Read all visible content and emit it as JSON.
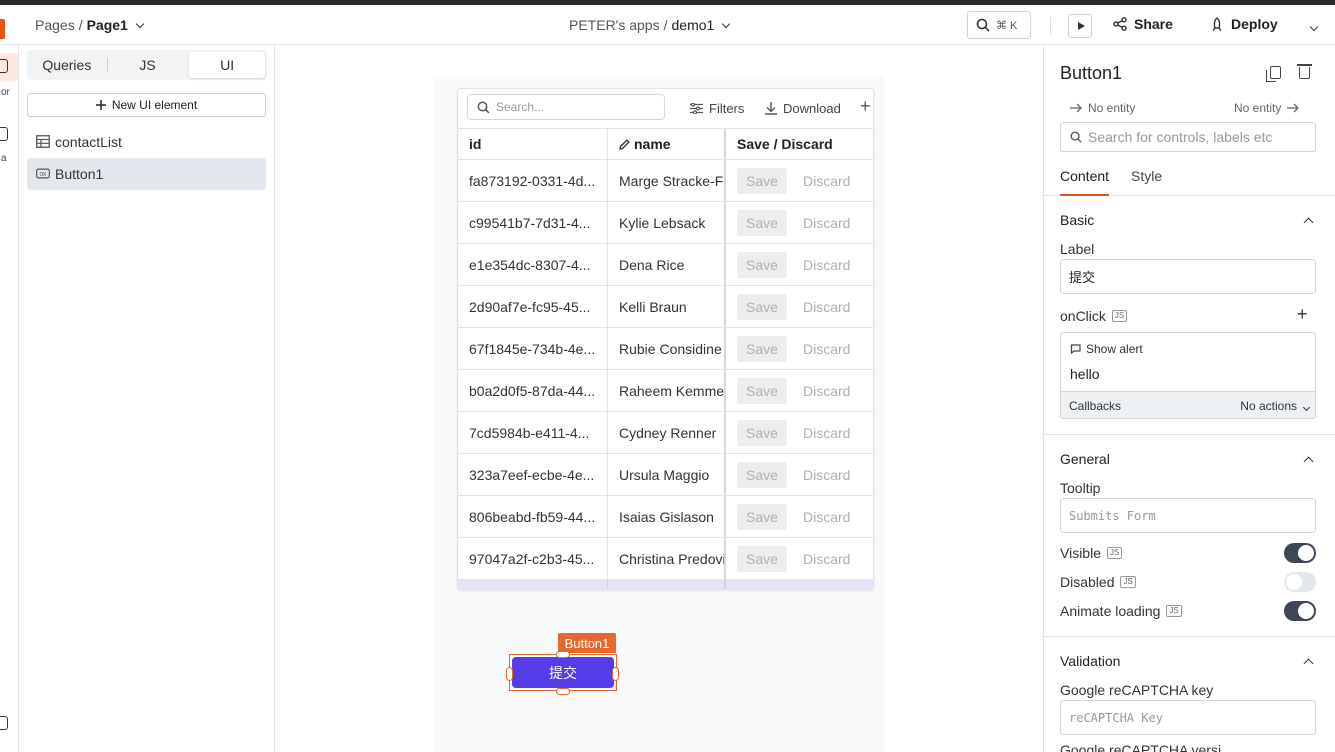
{
  "header": {
    "breadcrumb_root": "Pages",
    "breadcrumb_sep": "/",
    "breadcrumb_page": "Page1",
    "workspace": "PETER's apps",
    "app_sep": "/",
    "app_name": "demo1",
    "search_shortcut": "⌘ K",
    "share_label": "Share",
    "deploy_label": "Deploy"
  },
  "rail": {
    "label_top": "or",
    "label_mid": "a"
  },
  "left_panel": {
    "tabs": [
      "Queries",
      "JS",
      "UI"
    ],
    "active_tab": "UI",
    "new_element_label": "New UI element",
    "items": [
      {
        "label": "contactList",
        "icon": "table-icon",
        "selected": false
      },
      {
        "label": "Button1",
        "icon": "button-widget-icon",
        "selected": true
      }
    ]
  },
  "table": {
    "search_placeholder": "Search...",
    "filters_label": "Filters",
    "download_label": "Download",
    "columns": [
      "id",
      "name",
      "Save / Discard"
    ],
    "save_label": "Save",
    "discard_label": "Discard",
    "rows": [
      {
        "id": "fa873192-0331-4d...",
        "name": "Marge Stracke-Fr"
      },
      {
        "id": "c99541b7-7d31-4...",
        "name": "Kylie Lebsack"
      },
      {
        "id": "e1e354dc-8307-4...",
        "name": "Dena Rice"
      },
      {
        "id": "2d90af7e-fc95-45...",
        "name": "Kelli Braun"
      },
      {
        "id": "67f1845e-734b-4e...",
        "name": "Rubie Considine"
      },
      {
        "id": "b0a2d0f5-87da-44...",
        "name": "Raheem Kemme"
      },
      {
        "id": "7cd5984b-e411-4...",
        "name": "Cydney Renner"
      },
      {
        "id": "323a7eef-ecbe-4e...",
        "name": "Ursula Maggio"
      },
      {
        "id": "806beabd-fb59-44...",
        "name": "Isaias Gislason"
      },
      {
        "id": "97047a2f-c2b3-45...",
        "name": "Christina Predovi"
      }
    ]
  },
  "canvas_button": {
    "tag": "Button1",
    "label": "提交",
    "color": "#553de9"
  },
  "props": {
    "title": "Button1",
    "entity_left": "No entity",
    "entity_right": "No entity",
    "search_placeholder": "Search for controls, labels etc",
    "tabs": [
      "Content",
      "Style"
    ],
    "basic_section": "Basic",
    "label_field": "Label",
    "label_value": "提交",
    "onclick_field": "onClick",
    "js_badge": "JS",
    "action_title": "Show alert",
    "action_value": "hello",
    "callbacks_label": "Callbacks",
    "callbacks_value": "No actions",
    "general_section": "General",
    "tooltip_field": "Tooltip",
    "tooltip_placeholder": "Submits Form",
    "visible_label": "Visible",
    "visible_on": true,
    "disabled_label": "Disabled",
    "disabled_on": false,
    "animate_label": "Animate loading",
    "animate_on": true,
    "validation_section": "Validation",
    "recaptcha_field": "Google reCAPTCHA key",
    "recaptcha_placeholder": "reCAPTCHA Key",
    "recaptcha_version_cut": "Google reCAPTCHA versi"
  },
  "colors": {
    "accent": "#e15615",
    "button": "#553de9",
    "toggle_on": "#3e4756"
  }
}
